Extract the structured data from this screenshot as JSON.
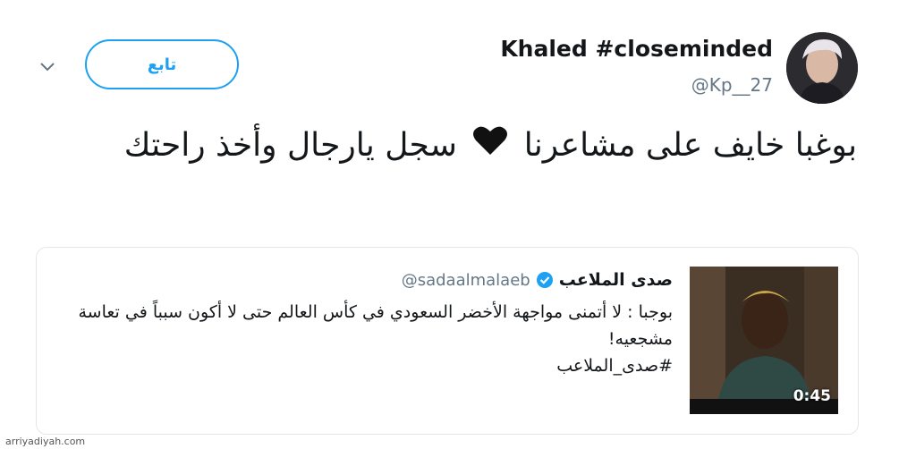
{
  "tweet": {
    "display_name": "Khaled #closeminded",
    "handle": "@Kp__27",
    "follow_label": "تابع",
    "text_before_heart": "بوغبا خايف على مشاعرنا",
    "text_after_heart": "سجل يارجال وأخذ راحتك",
    "heart_color": "#111111"
  },
  "quoted": {
    "name": "صدى الملاعب",
    "handle": "@sadaalmalaeb",
    "verified_color": "#1da1f2",
    "line1": "بوجبا : لا أتمنى مواجهة الأخضر السعودي في كأس العالم حتى لا أكون سبباً في تعاسة مشجعيه!",
    "hashtag": "#صدى_الملاعب",
    "video_duration": "0:45"
  },
  "watermark": "arriyadiyah.com",
  "colors": {
    "accent": "#1da1f2",
    "muted": "#657786"
  }
}
